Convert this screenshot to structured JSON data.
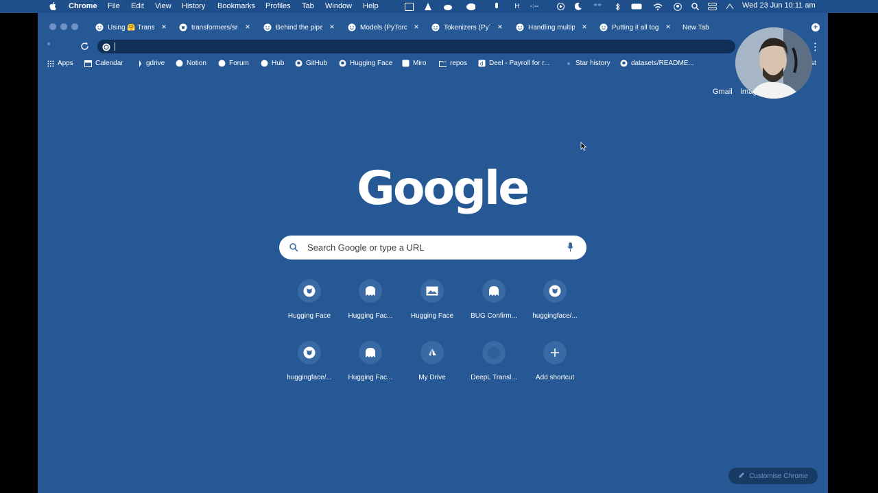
{
  "menubar": {
    "app_name": "Chrome",
    "items": [
      "File",
      "Edit",
      "View",
      "History",
      "Bookmarks",
      "Profiles",
      "Tab",
      "Window",
      "Help"
    ],
    "datetime": "Wed 23 Jun  10:11 am"
  },
  "tabs": [
    {
      "title": "Using 🤗 Trans",
      "icon": "hugging-face-icon"
    },
    {
      "title": "transformers/src",
      "icon": "github-icon"
    },
    {
      "title": "Behind the pipel",
      "icon": "hugging-face-icon"
    },
    {
      "title": "Models (PyTorch)",
      "icon": "hugging-face-icon"
    },
    {
      "title": "Tokenizers (PyT",
      "icon": "hugging-face-icon"
    },
    {
      "title": "Handling multip",
      "icon": "hugging-face-icon"
    },
    {
      "title": "Putting it all tog",
      "icon": "hugging-face-icon"
    },
    {
      "title": "New Tab",
      "icon": "",
      "active": true
    }
  ],
  "address_bar": {
    "value": ""
  },
  "bookmarks": [
    {
      "label": "Apps",
      "icon": "apps-grid-icon"
    },
    {
      "label": "Calendar",
      "icon": "calendar-icon"
    },
    {
      "label": "gdrive",
      "icon": "drive-icon"
    },
    {
      "label": "Notion",
      "icon": "hugging-face-icon"
    },
    {
      "label": "Forum",
      "icon": "hugging-face-icon"
    },
    {
      "label": "Hub",
      "icon": "hugging-face-icon"
    },
    {
      "label": "GitHub",
      "icon": "github-icon"
    },
    {
      "label": "Hugging Face",
      "icon": "github-icon"
    },
    {
      "label": "Miro",
      "icon": "miro-icon"
    },
    {
      "label": "repos",
      "icon": "folder-icon"
    },
    {
      "label": "Deel - Payroll for r...",
      "icon": "deel-icon"
    },
    {
      "label": "Star history",
      "icon": "star-icon"
    },
    {
      "label": "datasets/README...",
      "icon": "github-icon"
    }
  ],
  "bookmark_overflow": "st",
  "top_links": {
    "gmail": "Gmail",
    "images": "Imag"
  },
  "search": {
    "placeholder": "Search Google or type a URL"
  },
  "logo_text": "Google",
  "shortcuts": [
    {
      "label": "Hugging Face",
      "icon": "github-icon"
    },
    {
      "label": "Hugging Fac...",
      "icon": "hugging-face-icon"
    },
    {
      "label": "Hugging Face",
      "icon": "image-icon"
    },
    {
      "label": "BUG Confirm...",
      "icon": "hugging-face-icon"
    },
    {
      "label": "huggingface/...",
      "icon": "github-icon"
    },
    {
      "label": "huggingface/...",
      "icon": "github-icon"
    },
    {
      "label": "Hugging Fac...",
      "icon": "hugging-face-icon"
    },
    {
      "label": "My Drive",
      "icon": "drive-icon"
    },
    {
      "label": "DeepL Transl...",
      "icon": "deepl-icon"
    },
    {
      "label": "Add shortcut",
      "icon": "plus-icon"
    }
  ],
  "customise_label": "Customise Chrome",
  "colors": {
    "page_bg": "#255894",
    "menubar_bg": "#1f4f8a",
    "omnibox_bg": "#0f2f57"
  }
}
